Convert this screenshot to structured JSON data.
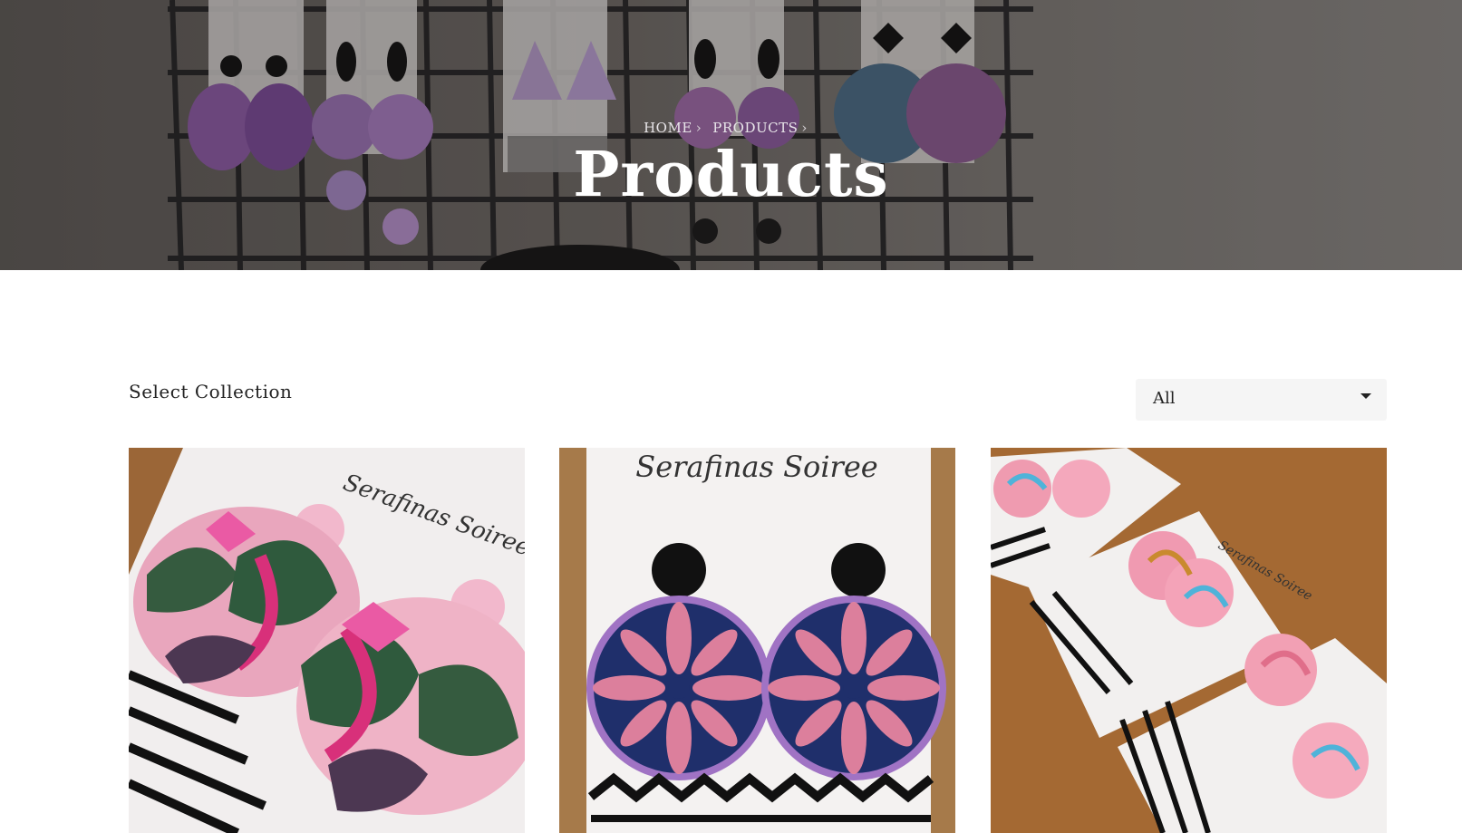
{
  "hero": {
    "breadcrumb": [
      {
        "label": "HOME"
      },
      {
        "label": "PRODUCTS"
      }
    ],
    "title": "Products"
  },
  "filter": {
    "label": "Select Collection",
    "selected": "All"
  },
  "products": [
    {
      "image": "pink-green-leaf-earrings",
      "card_text": "Serafinas Soiree"
    },
    {
      "image": "blue-pink-kaleidoscope-earrings",
      "card_text": "Serafinas Soiree"
    },
    {
      "image": "pastel-marble-stud-earrings",
      "card_text": "Serafinas Soiree"
    }
  ],
  "colors": {
    "accent_pink": "#d8307a",
    "navy": "#1f2f6b",
    "wood": "#a06a3a"
  }
}
